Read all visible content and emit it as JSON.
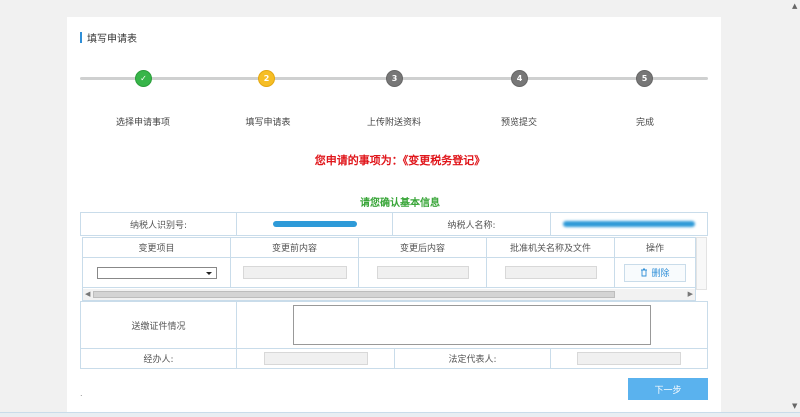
{
  "section": {
    "title": "填写申请表"
  },
  "steps": [
    {
      "num": "✓",
      "label": "选择申请事项",
      "state": "done"
    },
    {
      "num": "2",
      "label": "填写申请表",
      "state": "current"
    },
    {
      "num": "3",
      "label": "上传附送资料",
      "state": "todo"
    },
    {
      "num": "4",
      "label": "预览提交",
      "state": "todo"
    },
    {
      "num": "5",
      "label": "完成",
      "state": "todo"
    }
  ],
  "notice": "您申请的事项为：《变更税务登记》",
  "confirm_title": "请您确认基本信息",
  "info": {
    "taxpayer_id_label": "纳税人识别号:",
    "taxpayer_name_label": "纳税人名称:"
  },
  "changes_table": {
    "headers": [
      "变更项目",
      "变更前内容",
      "变更后内容",
      "批准机关名称及文件",
      "操作"
    ],
    "delete_label": "删除"
  },
  "certificate_label": "送缴证件情况",
  "handler_label": "经办人:",
  "legal_rep_label": "法定代表人:",
  "next_label": "下一步",
  "footer_mark": "."
}
